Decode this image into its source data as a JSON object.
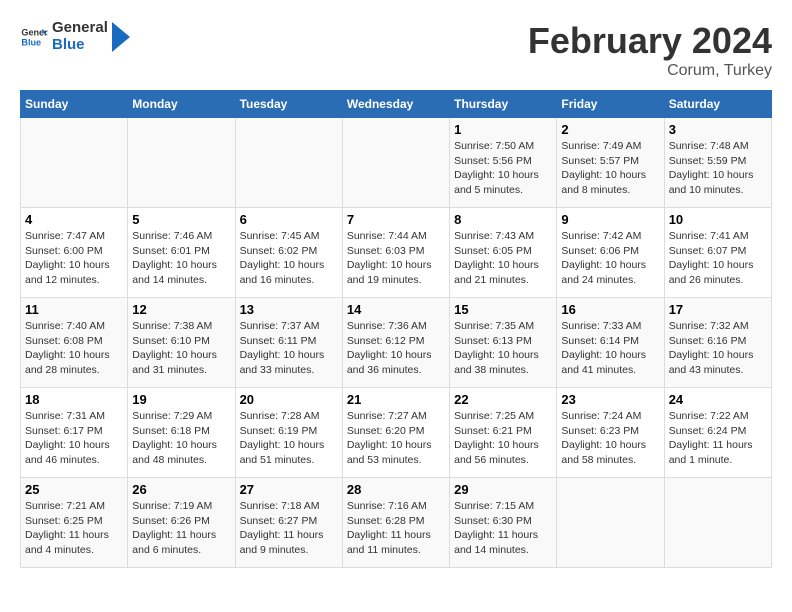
{
  "header": {
    "logo_general": "General",
    "logo_blue": "Blue",
    "main_title": "February 2024",
    "subtitle": "Corum, Turkey"
  },
  "calendar": {
    "days_of_week": [
      "Sunday",
      "Monday",
      "Tuesday",
      "Wednesday",
      "Thursday",
      "Friday",
      "Saturday"
    ],
    "weeks": [
      [
        {
          "day": "",
          "info": ""
        },
        {
          "day": "",
          "info": ""
        },
        {
          "day": "",
          "info": ""
        },
        {
          "day": "",
          "info": ""
        },
        {
          "day": "1",
          "info": "Sunrise: 7:50 AM\nSunset: 5:56 PM\nDaylight: 10 hours\nand 5 minutes."
        },
        {
          "day": "2",
          "info": "Sunrise: 7:49 AM\nSunset: 5:57 PM\nDaylight: 10 hours\nand 8 minutes."
        },
        {
          "day": "3",
          "info": "Sunrise: 7:48 AM\nSunset: 5:59 PM\nDaylight: 10 hours\nand 10 minutes."
        }
      ],
      [
        {
          "day": "4",
          "info": "Sunrise: 7:47 AM\nSunset: 6:00 PM\nDaylight: 10 hours\nand 12 minutes."
        },
        {
          "day": "5",
          "info": "Sunrise: 7:46 AM\nSunset: 6:01 PM\nDaylight: 10 hours\nand 14 minutes."
        },
        {
          "day": "6",
          "info": "Sunrise: 7:45 AM\nSunset: 6:02 PM\nDaylight: 10 hours\nand 16 minutes."
        },
        {
          "day": "7",
          "info": "Sunrise: 7:44 AM\nSunset: 6:03 PM\nDaylight: 10 hours\nand 19 minutes."
        },
        {
          "day": "8",
          "info": "Sunrise: 7:43 AM\nSunset: 6:05 PM\nDaylight: 10 hours\nand 21 minutes."
        },
        {
          "day": "9",
          "info": "Sunrise: 7:42 AM\nSunset: 6:06 PM\nDaylight: 10 hours\nand 24 minutes."
        },
        {
          "day": "10",
          "info": "Sunrise: 7:41 AM\nSunset: 6:07 PM\nDaylight: 10 hours\nand 26 minutes."
        }
      ],
      [
        {
          "day": "11",
          "info": "Sunrise: 7:40 AM\nSunset: 6:08 PM\nDaylight: 10 hours\nand 28 minutes."
        },
        {
          "day": "12",
          "info": "Sunrise: 7:38 AM\nSunset: 6:10 PM\nDaylight: 10 hours\nand 31 minutes."
        },
        {
          "day": "13",
          "info": "Sunrise: 7:37 AM\nSunset: 6:11 PM\nDaylight: 10 hours\nand 33 minutes."
        },
        {
          "day": "14",
          "info": "Sunrise: 7:36 AM\nSunset: 6:12 PM\nDaylight: 10 hours\nand 36 minutes."
        },
        {
          "day": "15",
          "info": "Sunrise: 7:35 AM\nSunset: 6:13 PM\nDaylight: 10 hours\nand 38 minutes."
        },
        {
          "day": "16",
          "info": "Sunrise: 7:33 AM\nSunset: 6:14 PM\nDaylight: 10 hours\nand 41 minutes."
        },
        {
          "day": "17",
          "info": "Sunrise: 7:32 AM\nSunset: 6:16 PM\nDaylight: 10 hours\nand 43 minutes."
        }
      ],
      [
        {
          "day": "18",
          "info": "Sunrise: 7:31 AM\nSunset: 6:17 PM\nDaylight: 10 hours\nand 46 minutes."
        },
        {
          "day": "19",
          "info": "Sunrise: 7:29 AM\nSunset: 6:18 PM\nDaylight: 10 hours\nand 48 minutes."
        },
        {
          "day": "20",
          "info": "Sunrise: 7:28 AM\nSunset: 6:19 PM\nDaylight: 10 hours\nand 51 minutes."
        },
        {
          "day": "21",
          "info": "Sunrise: 7:27 AM\nSunset: 6:20 PM\nDaylight: 10 hours\nand 53 minutes."
        },
        {
          "day": "22",
          "info": "Sunrise: 7:25 AM\nSunset: 6:21 PM\nDaylight: 10 hours\nand 56 minutes."
        },
        {
          "day": "23",
          "info": "Sunrise: 7:24 AM\nSunset: 6:23 PM\nDaylight: 10 hours\nand 58 minutes."
        },
        {
          "day": "24",
          "info": "Sunrise: 7:22 AM\nSunset: 6:24 PM\nDaylight: 11 hours\nand 1 minute."
        }
      ],
      [
        {
          "day": "25",
          "info": "Sunrise: 7:21 AM\nSunset: 6:25 PM\nDaylight: 11 hours\nand 4 minutes."
        },
        {
          "day": "26",
          "info": "Sunrise: 7:19 AM\nSunset: 6:26 PM\nDaylight: 11 hours\nand 6 minutes."
        },
        {
          "day": "27",
          "info": "Sunrise: 7:18 AM\nSunset: 6:27 PM\nDaylight: 11 hours\nand 9 minutes."
        },
        {
          "day": "28",
          "info": "Sunrise: 7:16 AM\nSunset: 6:28 PM\nDaylight: 11 hours\nand 11 minutes."
        },
        {
          "day": "29",
          "info": "Sunrise: 7:15 AM\nSunset: 6:30 PM\nDaylight: 11 hours\nand 14 minutes."
        },
        {
          "day": "",
          "info": ""
        },
        {
          "day": "",
          "info": ""
        }
      ]
    ]
  }
}
